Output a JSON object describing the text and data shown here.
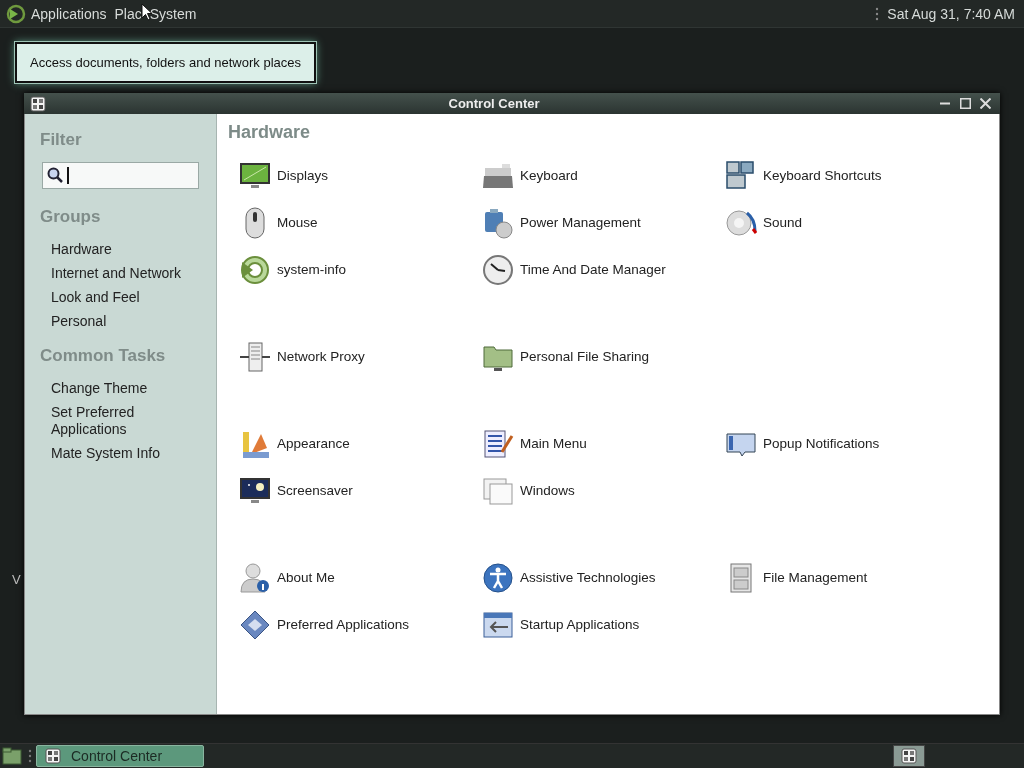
{
  "top_panel": {
    "menus": [
      {
        "label": "Applications"
      },
      {
        "label": "Plac"
      },
      {
        "label": "System"
      }
    ],
    "clock": "Sat Aug 31,  7:40 AM"
  },
  "tooltip": "Access documents, folders and network places",
  "desktop_labels": [
    "V"
  ],
  "window": {
    "title": "Control Center",
    "sidebar": {
      "filter_heading": "Filter",
      "groups_heading": "Groups",
      "groups": [
        {
          "label": "Hardware"
        },
        {
          "label": "Internet and Network"
        },
        {
          "label": "Look and Feel"
        },
        {
          "label": "Personal"
        }
      ],
      "tasks_heading": "Common Tasks",
      "tasks": [
        {
          "label": "Change Theme"
        },
        {
          "label": "Set Preferred Applications"
        },
        {
          "label": "Mate System Info"
        }
      ]
    },
    "sections": [
      {
        "title": "Hardware",
        "items": [
          {
            "label": "Displays"
          },
          {
            "label": "Keyboard"
          },
          {
            "label": "Keyboard Shortcuts"
          },
          {
            "label": "Mouse"
          },
          {
            "label": "Power Management"
          },
          {
            "label": "Sound"
          },
          {
            "label": "system-info"
          },
          {
            "label": "Time And Date Manager"
          }
        ]
      },
      {
        "items": [
          {
            "label": "Network Proxy"
          },
          {
            "label": "Personal File Sharing"
          }
        ]
      },
      {
        "items": [
          {
            "label": "Appearance"
          },
          {
            "label": "Main Menu"
          },
          {
            "label": "Popup Notifications"
          },
          {
            "label": "Screensaver"
          },
          {
            "label": "Windows"
          }
        ]
      },
      {
        "items": [
          {
            "label": "About Me"
          },
          {
            "label": "Assistive Technologies"
          },
          {
            "label": "File Management"
          },
          {
            "label": "Preferred Applications"
          },
          {
            "label": "Startup Applications"
          }
        ]
      }
    ]
  },
  "taskbar": {
    "tasks": [
      {
        "label": "Control Center",
        "selected": true
      }
    ]
  }
}
